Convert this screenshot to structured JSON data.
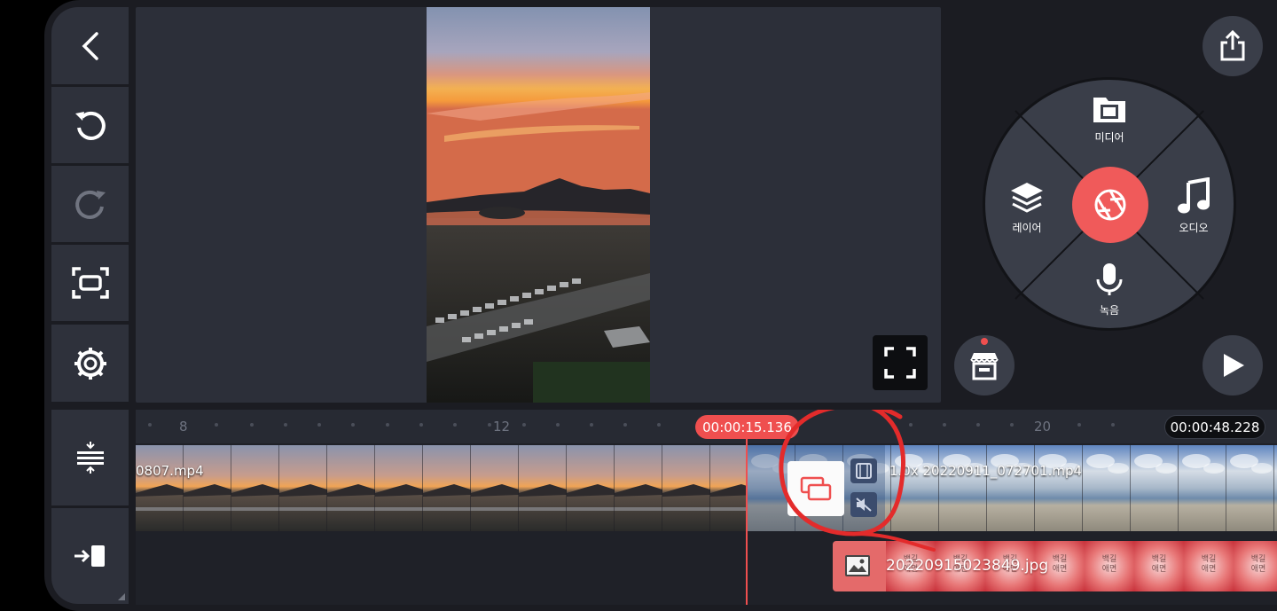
{
  "toolbar": {
    "back": "back-icon",
    "undo": "undo-icon",
    "redo": "redo-icon",
    "capture": "capture-icon",
    "settings": "settings-icon",
    "adjust_tracks": "adjust-tracks-icon",
    "jump_to_end": "jump-to-end-icon"
  },
  "wheel": {
    "media_label": "미디어",
    "layer_label": "레이어",
    "audio_label": "오디오",
    "record_label": "녹음"
  },
  "timeline": {
    "ruler_labels": [
      "8",
      "12",
      "20"
    ],
    "playhead_time": "00:00:15.136",
    "total_time": "00:00:48.228",
    "clip1_label": "0807.mp4",
    "clip2_label": "1.0x 20220911_072701.mp4",
    "layer_label": "20220915023849.jpg",
    "layer_tile_text": "백길\n애면"
  },
  "colors": {
    "accent": "#ef4f4f",
    "panel": "#2e313b",
    "background": "#1b1c22"
  }
}
